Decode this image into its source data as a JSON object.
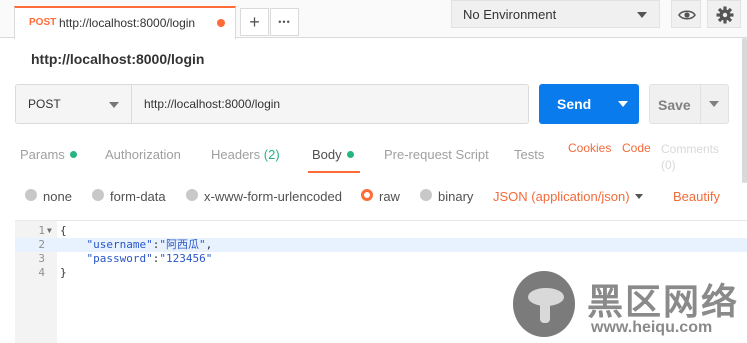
{
  "tab": {
    "method": "POST",
    "url": "http://localhost:8000/login",
    "new_tab_glyph": "+",
    "more_glyph": "•••"
  },
  "environment": {
    "label": "No Environment"
  },
  "request": {
    "title": "http://localhost:8000/login",
    "method": "POST",
    "url": "http://localhost:8000/login",
    "send_label": "Send",
    "save_label": "Save"
  },
  "subtabs": [
    {
      "label": "Params"
    },
    {
      "label": "Authorization"
    },
    {
      "label": "Headers",
      "count": "(2)"
    },
    {
      "label": "Body"
    },
    {
      "label": "Pre-request Script"
    },
    {
      "label": "Tests"
    }
  ],
  "links": {
    "cookies": "Cookies",
    "code": "Code",
    "comments": "Comments",
    "comments_count": "(0)"
  },
  "body_types": {
    "none": "none",
    "form_data": "form-data",
    "urlencoded": "x-www-form-urlencoded",
    "raw": "raw",
    "binary": "binary",
    "selected": "raw",
    "content_type": "JSON (application/json)",
    "beautify": "Beautify"
  },
  "editor": {
    "lines": [
      {
        "n": "1",
        "pre": "{",
        "key": "",
        "mid": "",
        "val": "",
        "post": ""
      },
      {
        "n": "2",
        "pre": "    ",
        "key": "\"username\"",
        "mid": ":",
        "val": "\"阿西瓜\"",
        "post": ","
      },
      {
        "n": "3",
        "pre": "    ",
        "key": "\"password\"",
        "mid": ":",
        "val": "\"123456\"",
        "post": ""
      },
      {
        "n": "4",
        "pre": "}",
        "key": "",
        "mid": "",
        "val": "",
        "post": ""
      }
    ]
  },
  "watermark": {
    "title": "黑区网络",
    "url": "www.heiqu.com"
  },
  "colors": {
    "accent": "#ff6c37",
    "send": "#097bed",
    "status_dot": "#26b47f"
  }
}
